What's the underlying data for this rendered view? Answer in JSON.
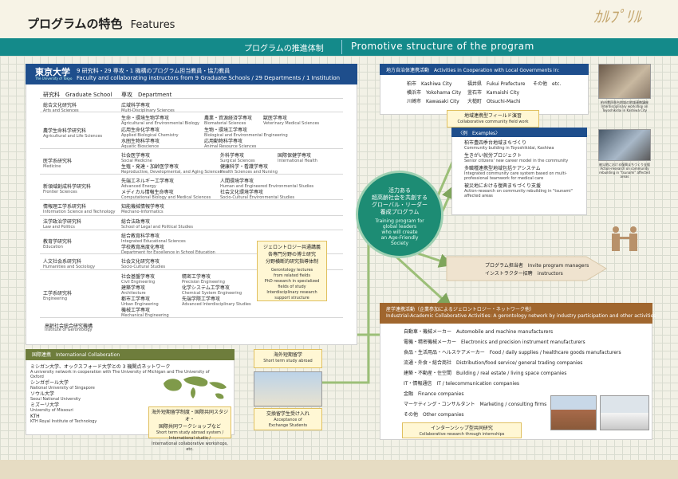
{
  "header": {
    "title_jp": "プログラムの特色",
    "title_en": "Features",
    "logo_text": "ｶﾙﾌﾟﾘﾙ"
  },
  "band": {
    "label_jp": "プログラムの推進体制",
    "label_en": "Promotive structure of the program"
  },
  "university": {
    "name_jp": "東京大学",
    "name_en": "The University of Tokyo",
    "summary_jp": "9 研究科・29 専攻・1 機構のプログラム担当教員・協力教員",
    "summary_en": "Faculty and collaborating instructors from 9 Graduate Schools / 29 Departments / 1 Institution",
    "col_gs": "研究科　Graduate School",
    "col_dept": "専攻　Department"
  },
  "schools": [
    {
      "jp": "総合文化研究科",
      "en": "Arts and Sciences"
    },
    {
      "jp": "農学生命科学研究科",
      "en": "Agricultural and Life Sciences"
    },
    {
      "jp": "医学系研究科",
      "en": "Medicine"
    },
    {
      "jp": "新領域創成科学研究科",
      "en": "Frontier Sciences"
    },
    {
      "jp": "情報理工学系研究科",
      "en": "Information Science and Technology"
    },
    {
      "jp": "法学政治学研究科",
      "en": "Law and Politics"
    },
    {
      "jp": "教育学研究科",
      "en": "Education"
    },
    {
      "jp": "人文社会系研究科",
      "en": "Humanities and Sociology"
    },
    {
      "jp": "工学系研究科",
      "en": "Engineering"
    }
  ],
  "departments": [
    {
      "jp": "広域科学専攻",
      "en": "Multi-Disciplinary Sciences"
    },
    {
      "jp": "生命・環境生物学専攻",
      "en": "Agricultural and Environmental Biology"
    },
    {
      "jp": "応用生命化学専攻",
      "en": "Applied Biological Chemistry"
    },
    {
      "jp": "水圏生物科学専攻",
      "en": "Aquatic Bioscience"
    },
    {
      "jp": "農業・資源経済学専攻",
      "en": "Biomaterial Sciences"
    },
    {
      "jp": "生物・環境工学専攻",
      "en": "Biological and Environmental Engineering"
    },
    {
      "jp": "応用動物科学専攻",
      "en": "Animal Resource Sciences"
    },
    {
      "jp": "獣医学専攻",
      "en": "Veterinary Medical Sciences"
    },
    {
      "jp": "社会医学専攻",
      "en": "Social Medicine"
    },
    {
      "jp": "生殖・発達・加齢医学専攻",
      "en": "Reproductive, Developmental, and Aging Sciences"
    },
    {
      "jp": "外科学専攻",
      "en": "Surgical Sciences"
    },
    {
      "jp": "健康科学・看護学専攻",
      "en": "Health Sciences and Nursing"
    },
    {
      "jp": "国際保健学専攻",
      "en": "International Health"
    },
    {
      "jp": "先端エネルギー工学専攻",
      "en": "Advanced Energy"
    },
    {
      "jp": "メディカル情報生命専攻",
      "en": "Computational Biology and Medical Sciences"
    },
    {
      "jp": "人間環境学専攻",
      "en": "Human and Engineered Environmental Studies"
    },
    {
      "jp": "社会文化環境学専攻",
      "en": "Socio-Cultural Environmental Studies"
    },
    {
      "jp": "知能機械情報学専攻",
      "en": "Mechano-Informatics"
    },
    {
      "jp": "総合法政専攻",
      "en": "School of Legal and Political Studies"
    },
    {
      "jp": "総合教育科学専攻",
      "en": "Integrated Educational Sciences"
    },
    {
      "jp": "学校教育高度化専攻",
      "en": "Department for Excellence in School Education"
    },
    {
      "jp": "社会文化研究専攻",
      "en": "Socio-Cultural Studies"
    },
    {
      "jp": "社会基盤学専攻",
      "en": "Civil Engineering"
    },
    {
      "jp": "建築学専攻",
      "en": "Architecture"
    },
    {
      "jp": "都市工学専攻",
      "en": "Urban Engineering"
    },
    {
      "jp": "機械工学専攻",
      "en": "Mechanical Engineering"
    },
    {
      "jp": "精密工学専攻",
      "en": "Precision Engineering"
    },
    {
      "jp": "化学システム工学専攻",
      "en": "Chemical System Engineering"
    },
    {
      "jp": "先端学際工学専攻",
      "en": "Advanced Interdisciplinary Studies"
    }
  ],
  "institute": {
    "jp": "高齢社会総合研究機構",
    "en": "Institute of Gerontology"
  },
  "gerontology_callout": {
    "jp1": "ジェロントロジー共通講義",
    "jp2": "各専門分野の博士研究",
    "jp3": "分野横断的研究指導体制",
    "en1": "Gerontology lectures",
    "en2": "from related fields",
    "en3": "PhD research in specialized",
    "en4": "fields of study",
    "en5": "Interdisciplinary research",
    "en6": "support structure"
  },
  "center": {
    "jp1": "活力ある",
    "jp2": "超高齢社会を共創する",
    "jp3": "グローバル・リーダー",
    "jp4": "養成プログラム",
    "en1": "Training program for",
    "en2": "global leaders",
    "en3": "who will create",
    "en4": "an Age-Friendly",
    "en5": "Society"
  },
  "intl": {
    "title": "国際連携　International Collaboration",
    "items": [
      {
        "jp": "ミシガン大学、オックスフォード大学との 3 機関点ネットワーク",
        "en": "A university network in cooperation with The University of Michigan and The University of Oxford"
      },
      {
        "jp": "シンガポール大学",
        "en": "National University of Singapore"
      },
      {
        "jp": "ソウル大学",
        "en": "Seoul National University"
      },
      {
        "jp": "ミズーリ大学",
        "en": "University of Missouri"
      },
      {
        "jp": "KTH",
        "en": "KTH Royal Institute of Technology"
      }
    ],
    "study_abroad": {
      "jp": "海外短期留学",
      "en": "Short term study abroad"
    },
    "system": {
      "jp1": "海外短期留学制度・国際共同スタジオ・",
      "jp2": "国際共同ワークショップなど",
      "en1": "Short term study abroad system /",
      "en2": "International studio /",
      "en3": "International collaborative workshops, etc."
    },
    "exchange": {
      "jp": "交換留学生受け入れ",
      "en1": "Acceptance of",
      "en2": "Exchange Students"
    }
  },
  "local_gov": {
    "title": "地方自治体連携活動　Activities in Cooperation with Local Governments in:",
    "cities": [
      {
        "jp": "柏市",
        "en": "Kashiwa City"
      },
      {
        "jp": "横浜市",
        "en": "Yokohama City"
      },
      {
        "jp": "川崎市",
        "en": "Kawasaki City"
      },
      {
        "jp": "福井県",
        "en": "Fukui Prefecture"
      },
      {
        "jp": "釜石市",
        "en": "Kamaishi City"
      },
      {
        "jp": "大槌町",
        "en": "Otsuchi-Machi"
      },
      {
        "jp": "その他",
        "en": "etc."
      }
    ],
    "field_work": {
      "jp": "地域連携型フィールド演習",
      "en": "Collaborative community field work"
    }
  },
  "examples": {
    "title": "〈例　Examples〉",
    "items": [
      {
        "jp": "柏市豊四季台地域まちづくり",
        "en": "Community building in Toyoshikidai, Kashiwa"
      },
      {
        "jp": "生きがい就労プロジェクト",
        "en": "Senior citizens' new career model in the community"
      },
      {
        "jp": "多職種連携型地域包括ケアシステム",
        "en": "Integrated community care system based on multi-professional teamwork for medical care"
      },
      {
        "jp": "被災地における復興まちづくり支援",
        "en": "Action-research on community rebuilding in \"tsunami\" affected areas"
      }
    ]
  },
  "photos": {
    "cap1": "柏市豊四季台地域の地域連携講座",
    "cap1_en": "Interdisciplinary workshop on Toyoshikidai in Kashiwa City",
    "cap2": "被災地における復興まちづくり支援",
    "cap2_en": "Action-research on community rebuilding in \"tsunami\" affected areas"
  },
  "managers": {
    "jp1": "プログラム担当者",
    "en1": "Invite program managers",
    "jp2": "インストラクター招聘",
    "en2": "instructors"
  },
  "industry": {
    "title1": "産学連携活動（企業参加によるジェロントロジー・ネットワーク他）",
    "title2": "Industrial-Academic Collaborative Activities: A gerontology network by industry participation and other activities",
    "rows": [
      {
        "jp": "自動車・機械メーカー",
        "en": "Automobile and machine manufacturers"
      },
      {
        "jp": "電機・精密機械メーカー",
        "en": "Electronics and precision instrument manufacturers"
      },
      {
        "jp": "食品・生活用品・ヘルスケアメーカー",
        "en": "Food / daily supplies / healthcare goods manufacturers"
      },
      {
        "jp": "流通・外食・総合商社",
        "en": "Distribution/food service/ general trading companies"
      },
      {
        "jp": "建築・不動産・住空間",
        "en": "Building / real estate / living space companies"
      },
      {
        "jp": "IT・情報通信",
        "en": "IT / telecommunication companies"
      },
      {
        "jp": "金融",
        "en": "Finance companies"
      },
      {
        "jp": "マーケティング・コンサルタント",
        "en": "Marketing / consulting firms"
      },
      {
        "jp": "その他",
        "en": "Other companies"
      }
    ],
    "internship": {
      "jp": "インターンシップ型共同研究",
      "en": "Collaborative research through internships"
    }
  },
  "colors": {
    "teal": "#148a8a",
    "navy": "#1e4e8c",
    "olive": "#6e7d3c",
    "brown": "#a0662e",
    "arrow_green": "#8fb36a"
  }
}
